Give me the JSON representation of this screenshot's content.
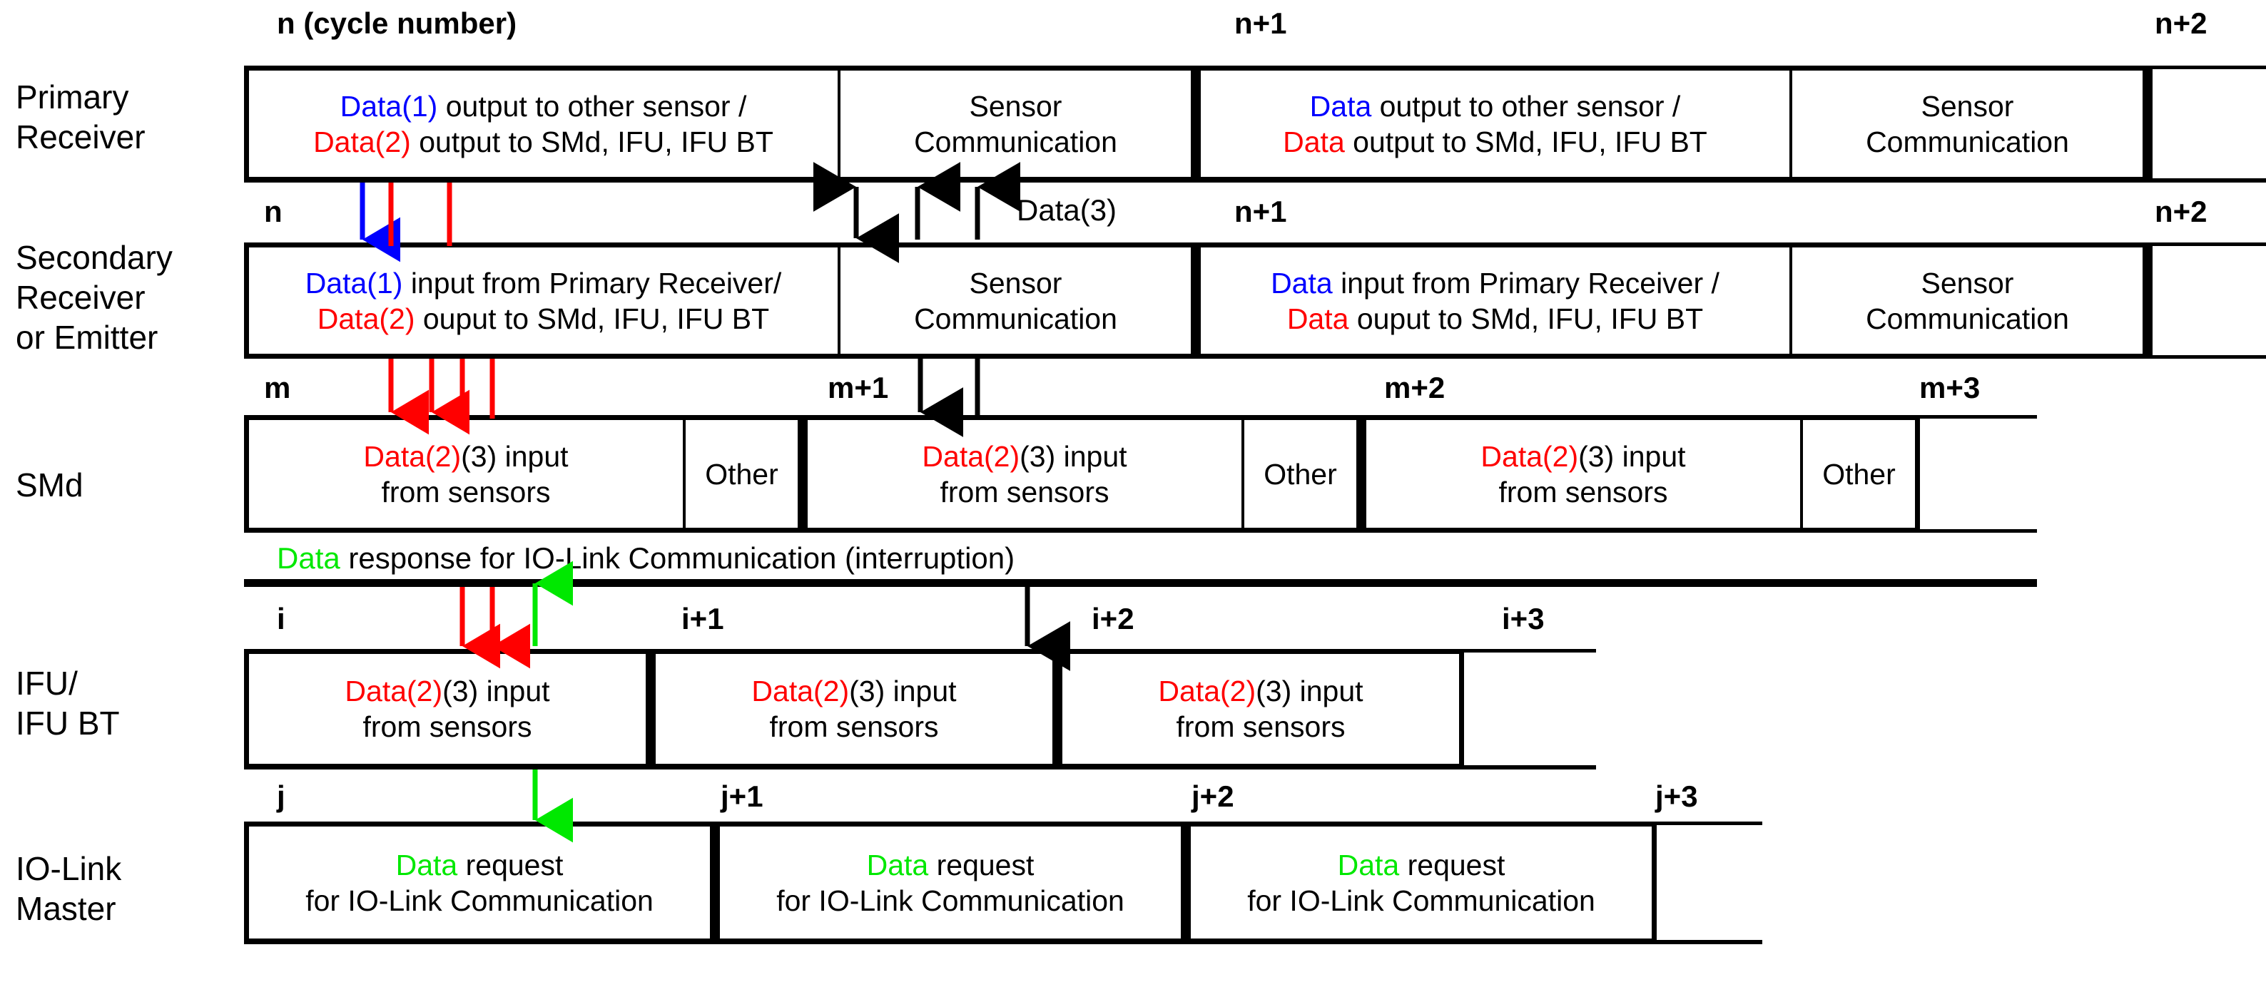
{
  "diagram": {
    "title": "Sensor / SMd / IFU / IO-Link Master cycle timing diagram",
    "colors": {
      "data1": "#0000ff",
      "data2": "#ff0000",
      "data_iolink": "#00e800",
      "line": "#000000",
      "background": "#ffffff"
    }
  },
  "rows": {
    "primary": {
      "label": "Primary\nReceiver",
      "ticks": [
        {
          "id": "n",
          "text": "n (cycle number)"
        },
        {
          "id": "n1",
          "text": "n+1"
        },
        {
          "id": "n2",
          "text": "n+2"
        }
      ],
      "slots": [
        {
          "kind": "data",
          "line1_tag": "Data(1)",
          "line1_rest": " output to other sensor /",
          "line2_tag": "Data(2)",
          "line2_rest": " output to SMd, IFU, IFU BT"
        },
        {
          "kind": "comm",
          "line1": "Sensor",
          "line2": "Communication"
        },
        {
          "kind": "data",
          "line1_tag": "Data",
          "line1_rest": " output to other sensor /",
          "line2_tag": "Data",
          "line2_rest": " output to SMd, IFU, IFU BT"
        },
        {
          "kind": "comm",
          "line1": "Sensor",
          "line2": "Communication"
        },
        {
          "kind": "empty",
          "text": ""
        }
      ]
    },
    "secondary": {
      "label": "Secondary\nReceiver\nor Emitter",
      "ticks": [
        {
          "id": "n",
          "text": "n"
        },
        {
          "id": "n1",
          "text": "n+1"
        },
        {
          "id": "n2",
          "text": "n+2"
        }
      ],
      "slots": [
        {
          "kind": "data",
          "line1_tag": "Data(1)",
          "line1_rest": " input from Primary Receiver/",
          "line2_tag": "Data(2)",
          "line2_rest": " ouput to SMd, IFU, IFU BT"
        },
        {
          "kind": "comm",
          "line1": "Sensor",
          "line2": "Communication"
        },
        {
          "kind": "data",
          "line1_tag": "Data",
          "line1_rest": " input from Primary Receiver /",
          "line2_tag": "Data",
          "line2_rest": " ouput to SMd, IFU, IFU BT"
        },
        {
          "kind": "comm",
          "line1": "Sensor",
          "line2": "Communication"
        },
        {
          "kind": "empty",
          "text": ""
        }
      ]
    },
    "smd": {
      "label": "SMd",
      "ticks": [
        {
          "id": "m",
          "text": "m"
        },
        {
          "id": "m1",
          "text": "m+1"
        },
        {
          "id": "m2",
          "text": "m+2"
        },
        {
          "id": "m3",
          "text": "m+3"
        }
      ],
      "slots": [
        {
          "kind": "data",
          "line1_tag": "Data(2)",
          "line1_rest": "(3) input",
          "line2": "from sensors"
        },
        {
          "kind": "other",
          "text": "Other"
        },
        {
          "kind": "data",
          "line1_tag": "Data(2)",
          "line1_rest": "(3) input",
          "line2": "from sensors"
        },
        {
          "kind": "other",
          "text": "Other"
        },
        {
          "kind": "data",
          "line1_tag": "Data(2)",
          "line1_rest": "(3) input",
          "line2": "from sensors"
        },
        {
          "kind": "other",
          "text": "Other"
        },
        {
          "kind": "empty",
          "text": ""
        }
      ]
    },
    "ifu": {
      "label": "IFU/\nIFU BT",
      "ticks": [
        {
          "id": "i",
          "text": "i"
        },
        {
          "id": "i1",
          "text": "i+1"
        },
        {
          "id": "i2",
          "text": "i+2"
        },
        {
          "id": "i3",
          "text": "i+3"
        }
      ],
      "slots": [
        {
          "kind": "data",
          "line1_tag": "Data(2)",
          "line1_rest": "(3) input",
          "line2": "from sensors"
        },
        {
          "kind": "data",
          "line1_tag": "Data(2)",
          "line1_rest": "(3) input",
          "line2": "from sensors"
        },
        {
          "kind": "data",
          "line1_tag": "Data(2)",
          "line1_rest": "(3) input",
          "line2": "from sensors"
        },
        {
          "kind": "empty",
          "text": ""
        }
      ]
    },
    "iolink": {
      "label": "IO-Link\nMaster",
      "ticks": [
        {
          "id": "j",
          "text": "j"
        },
        {
          "id": "j1",
          "text": "j+1"
        },
        {
          "id": "j2",
          "text": "j+2"
        },
        {
          "id": "j3",
          "text": "j+3"
        }
      ],
      "slots": [
        {
          "kind": "req",
          "line1_tag": "Data",
          "line1_rest": " request",
          "line2": "for IO-Link Communication"
        },
        {
          "kind": "req",
          "line1_tag": "Data",
          "line1_rest": " request",
          "line2": "for IO-Link Communication"
        },
        {
          "kind": "req",
          "line1_tag": "Data",
          "line1_rest": " request",
          "line2": "for IO-Link Communication"
        },
        {
          "kind": "empty",
          "text": ""
        }
      ]
    }
  },
  "annotations": {
    "data3": "Data(3)",
    "response_tag": "Data",
    "response_rest": " response for IO-Link Communication (interruption)"
  }
}
